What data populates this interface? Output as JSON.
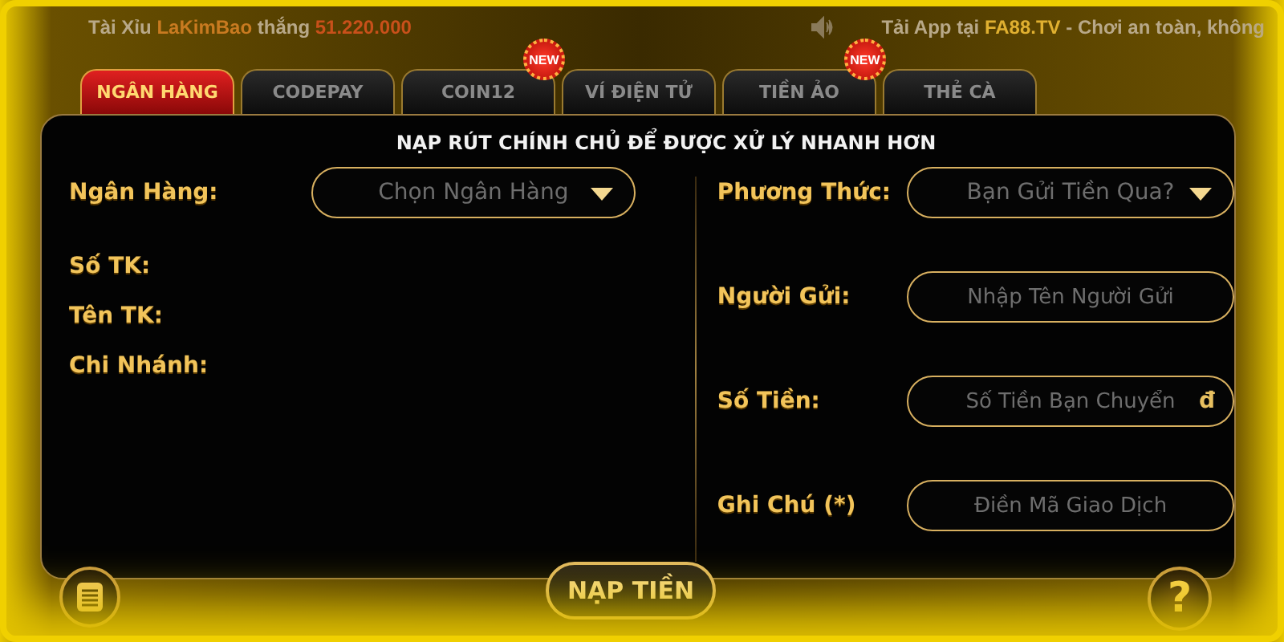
{
  "ticker": {
    "left": [
      {
        "text": "Tài Xỉu ",
        "kind": "plain"
      },
      {
        "text": "LaKimBao",
        "kind": "player"
      },
      {
        "text": " thắng ",
        "kind": "plain"
      },
      {
        "text": "51.220.000",
        "kind": "amount"
      }
    ],
    "right": [
      {
        "text": "Tải App tại ",
        "kind": "plain"
      },
      {
        "text": "FA88.TV",
        "kind": "site"
      },
      {
        "text": " - Chơi an toàn, không",
        "kind": "plain"
      }
    ]
  },
  "tabs": [
    {
      "label": "NGÂN HÀNG",
      "selected": true
    },
    {
      "label": "CODEPAY",
      "selected": false
    },
    {
      "label": "COIN12",
      "selected": false,
      "badge": "NEW"
    },
    {
      "label": "VÍ ĐIỆN TỬ",
      "selected": false
    },
    {
      "label": "TIỀN ẢO",
      "selected": false,
      "badge": "NEW"
    },
    {
      "label": "THẺ CÀ",
      "selected": false
    }
  ],
  "heading": "NẠP RÚT CHÍNH CHỦ ĐỂ ĐƯỢC XỬ LÝ NHANH HƠN",
  "left_fields": [
    {
      "label": "Ngân Hàng:",
      "kind": "select",
      "placeholder": "Chọn Ngân Hàng"
    },
    {
      "label": "Số TK:",
      "kind": "info"
    },
    {
      "label": "Tên TK:",
      "kind": "info"
    },
    {
      "label": "Chi Nhánh:",
      "kind": "info"
    }
  ],
  "right_fields": [
    {
      "label": "Phương Thức:",
      "kind": "select",
      "placeholder": "Bạn Gửi Tiền Qua?"
    },
    {
      "label": "Người Gửi:",
      "kind": "input",
      "placeholder": "Nhập Tên Người Gửi"
    },
    {
      "label": "Số Tiền:",
      "kind": "input",
      "placeholder": "Số Tiền Bạn Chuyển",
      "suffix": "đ"
    },
    {
      "label": "Ghi Chú (*)",
      "kind": "input",
      "placeholder": "Điền Mã Giao Dịch"
    }
  ],
  "submit_button": "NẠP TIỀN",
  "help_button": "?"
}
